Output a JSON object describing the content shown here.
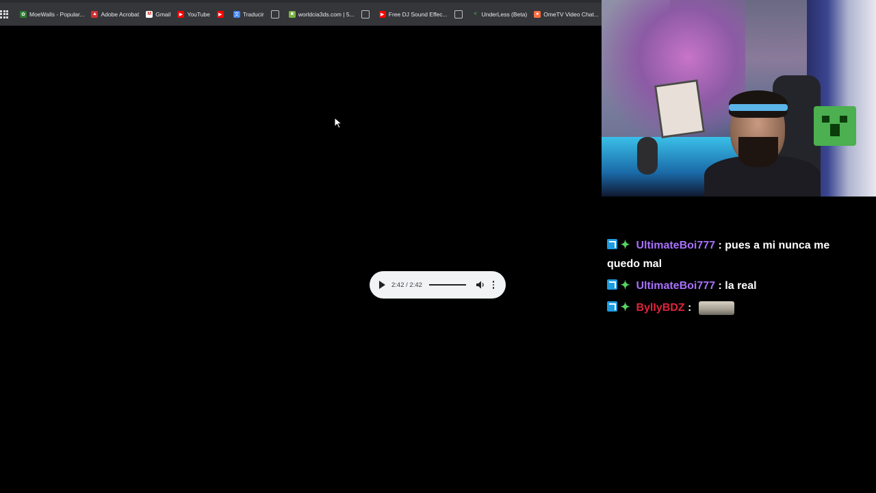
{
  "browser": {
    "bookmarks": [
      {
        "label": "MoeWalls - Popular...",
        "icon": "moewalls-icon"
      },
      {
        "label": "Adobe Acrobat",
        "icon": "acrobat-icon"
      },
      {
        "label": "Gmail",
        "icon": "gmail-icon"
      },
      {
        "label": "YouTube",
        "icon": "youtube-icon"
      },
      {
        "label": "",
        "icon": "youtube-icon"
      },
      {
        "label": "Traducir",
        "icon": "translate-icon"
      },
      {
        "label": "",
        "icon": "globe-icon"
      },
      {
        "label": "worldcia3ds.com | 5...",
        "icon": "worldcia-icon"
      },
      {
        "label": "",
        "icon": "globe-icon"
      },
      {
        "label": "Free DJ Sound Effec...",
        "icon": "youtube-icon"
      },
      {
        "label": "",
        "icon": "globe-icon"
      },
      {
        "label": "UnderLess (Beta)",
        "icon": "underless-icon"
      },
      {
        "label": "OmeTV Video Chat...",
        "icon": "ometv-icon"
      }
    ]
  },
  "audio_player": {
    "time": "2:42 / 2:42",
    "progress": 1.0,
    "icons": {
      "play": "play-icon",
      "volume": "volume-icon",
      "more": "more-options-icon"
    }
  },
  "chat": {
    "messages": [
      {
        "username": "UltimateBoi777",
        "separator": ":",
        "text": "pues a mi nunca me quedo mal",
        "color": "#a970ff"
      },
      {
        "username": "UltimateBoi777",
        "separator": ":",
        "text": "la real",
        "color": "#a970ff"
      },
      {
        "username": "BylIyBDZ",
        "separator": ":",
        "text": "",
        "color": "#e0243a"
      }
    ]
  },
  "colors": {
    "background": "#000000",
    "bookmarks_bar": "#35363a",
    "audio_player_bg": "#f1f3f4",
    "chat_username_purple": "#a970ff",
    "chat_username_red": "#e0243a"
  }
}
